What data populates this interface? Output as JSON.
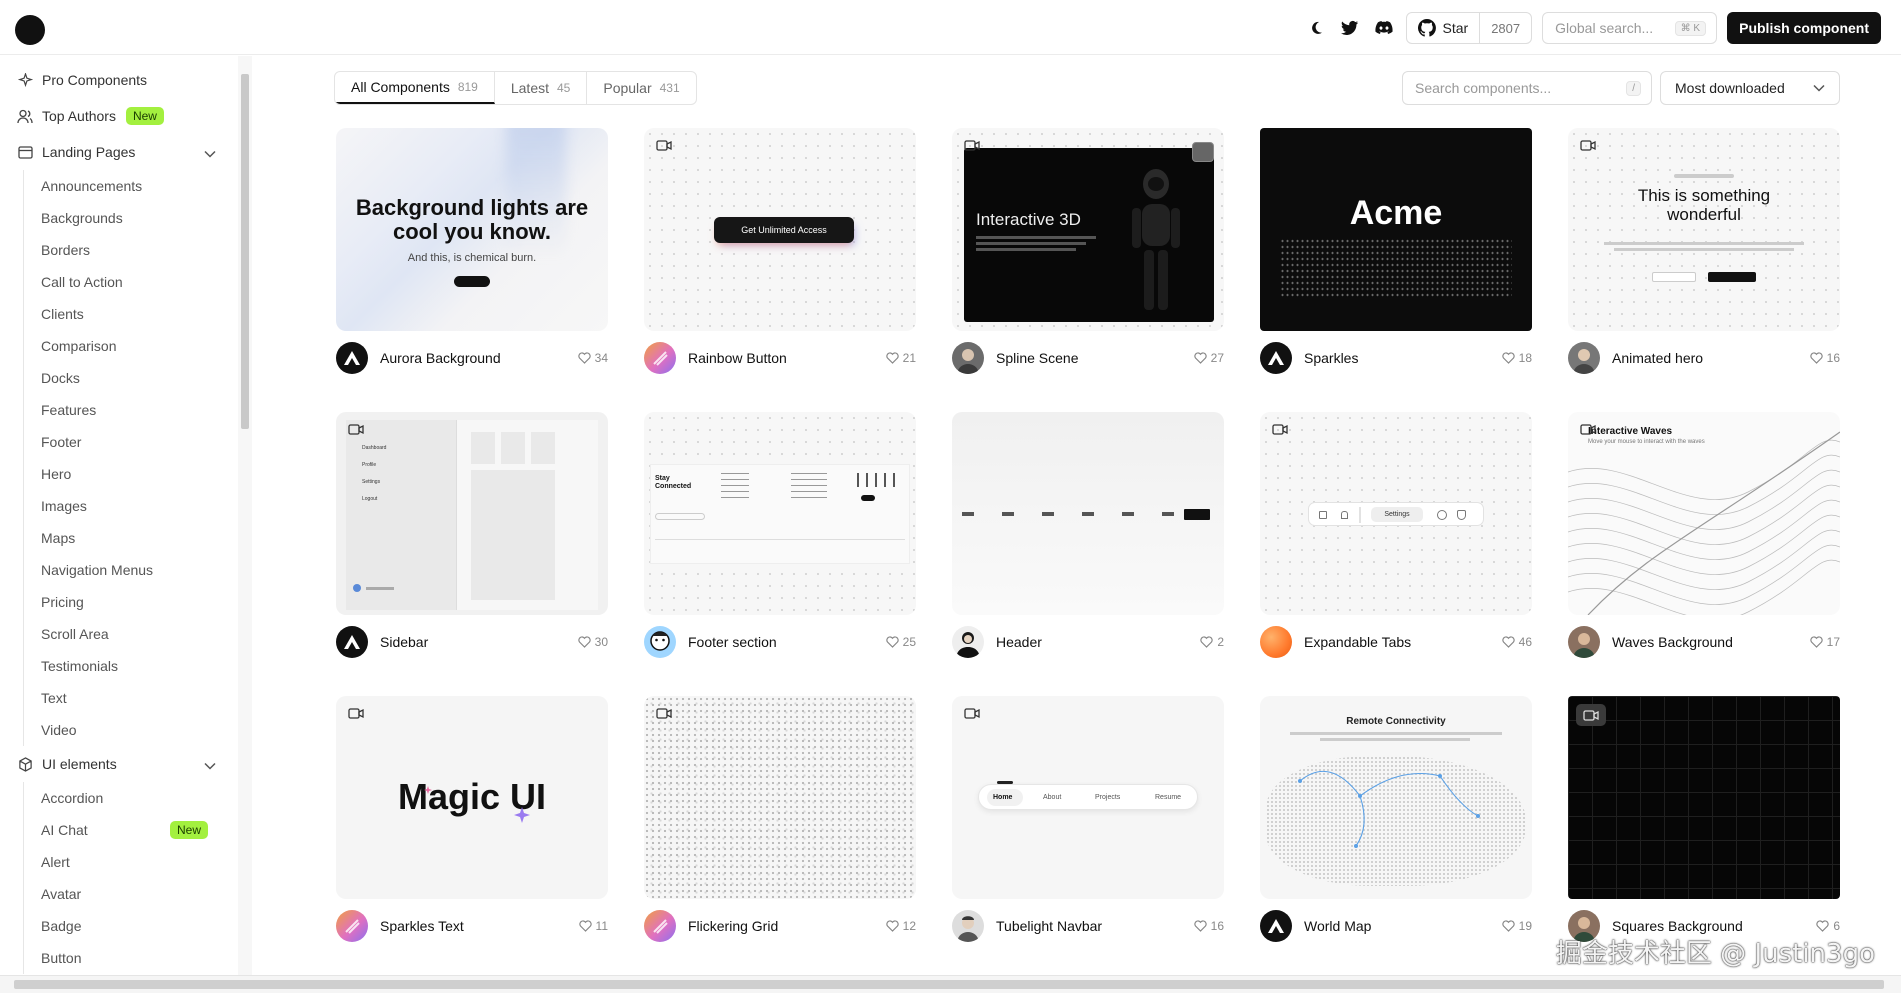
{
  "header": {
    "star_label": "Star",
    "star_count": "2807",
    "search_placeholder": "Global search...",
    "search_shortcut": "⌘ K",
    "publish_label": "Publish component"
  },
  "sidebar": {
    "pro_components": "Pro Components",
    "top_authors": "Top Authors",
    "top_authors_badge": "New",
    "landing_pages": "Landing Pages",
    "landing_items": [
      "Announcements",
      "Backgrounds",
      "Borders",
      "Call to Action",
      "Clients",
      "Comparison",
      "Docks",
      "Features",
      "Footer",
      "Hero",
      "Images",
      "Maps",
      "Navigation Menus",
      "Pricing",
      "Scroll Area",
      "Testimonials",
      "Text",
      "Video"
    ],
    "ui_elements": "UI elements",
    "ui_items": [
      "Accordion",
      "AI Chat",
      "Alert",
      "Avatar",
      "Badge",
      "Button"
    ],
    "ai_chat_badge": "New"
  },
  "tabs": [
    {
      "label": "All Components",
      "count": "819"
    },
    {
      "label": "Latest",
      "count": "45"
    },
    {
      "label": "Popular",
      "count": "431"
    }
  ],
  "search": {
    "placeholder": "Search components...",
    "shortcut": "/"
  },
  "sort": {
    "selected": "Most downloaded"
  },
  "cards": [
    {
      "name": "Aurora Background",
      "likes": "34",
      "avatar": "logo-a"
    },
    {
      "name": "Rainbow Button",
      "likes": "21",
      "avatar": "gradient"
    },
    {
      "name": "Spline Scene",
      "likes": "27",
      "avatar": "photo"
    },
    {
      "name": "Sparkles",
      "likes": "18",
      "avatar": "logo-a"
    },
    {
      "name": "Animated hero",
      "likes": "16",
      "avatar": "photo"
    },
    {
      "name": "Sidebar",
      "likes": "30",
      "avatar": "logo-a"
    },
    {
      "name": "Footer section",
      "likes": "25",
      "avatar": "cartoon"
    },
    {
      "name": "Header",
      "likes": "2",
      "avatar": "photo"
    },
    {
      "name": "Expandable Tabs",
      "likes": "46",
      "avatar": "orange"
    },
    {
      "name": "Waves Background",
      "likes": "17",
      "avatar": "photo"
    },
    {
      "name": "Sparkles Text",
      "likes": "11",
      "avatar": "gradient"
    },
    {
      "name": "Flickering Grid",
      "likes": "12",
      "avatar": "gradient"
    },
    {
      "name": "Tubelight Navbar",
      "likes": "16",
      "avatar": "photo"
    },
    {
      "name": "World Map",
      "likes": "19",
      "avatar": "logo-a"
    },
    {
      "name": "Squares Background",
      "likes": "6",
      "avatar": "photo"
    }
  ],
  "previews": {
    "aurora_title": "Background lights are cool you know.",
    "aurora_sub": "And this, is chemical burn.",
    "rainbow_btn": "Get Unlimited Access",
    "spline_title": "Interactive 3D",
    "sparkles_title": "Acme",
    "hero_title": "This is something wonderful",
    "sidebar_items": [
      "Dashboard",
      "Profile",
      "Settings",
      "Logout"
    ],
    "footer_title": "Stay Connected",
    "exp_tab": "Settings",
    "waves_title": "Interactive Waves",
    "waves_sub": "Move your mouse to interact with the waves",
    "magic_title": "Magic UI",
    "tube_items": [
      "Home",
      "About",
      "Projects",
      "Resume"
    ],
    "map_title": "Remote Connectivity"
  },
  "watermark": "掘金技术社区 @ Justin3go"
}
